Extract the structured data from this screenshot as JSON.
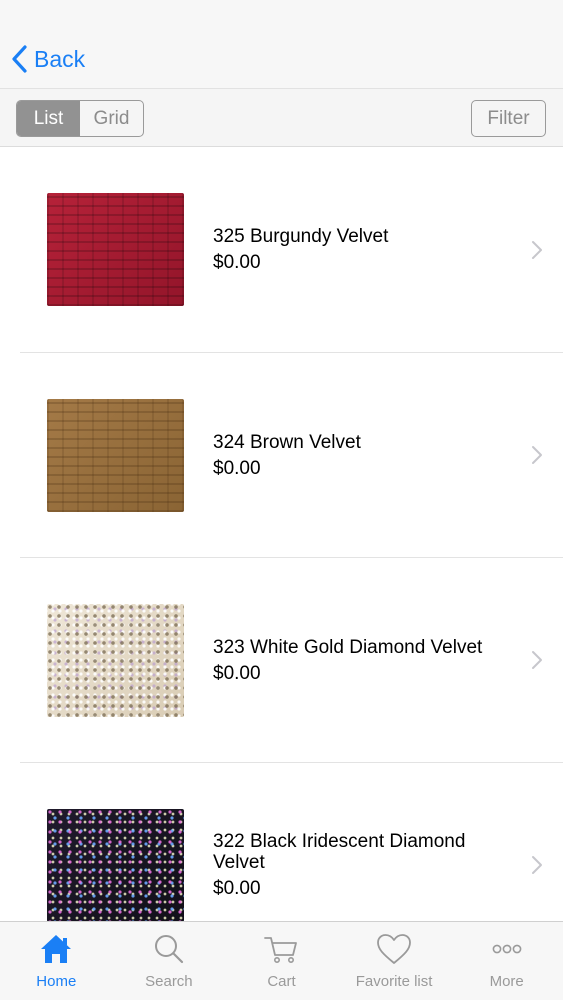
{
  "nav": {
    "back_label": "Back"
  },
  "toolbar": {
    "view_modes": [
      "List",
      "Grid"
    ],
    "active_view": "List",
    "filter_label": "Filter"
  },
  "products": [
    {
      "name": "325 Burgundy Velvet",
      "price": "$0.00",
      "swatch": "burgundy-velvet",
      "color": "#a71a33"
    },
    {
      "name": "324 Brown Velvet",
      "price": "$0.00",
      "swatch": "brown-velvet",
      "color": "#98703e"
    },
    {
      "name": "323 White Gold Diamond Velvet",
      "price": "$0.00",
      "swatch": "white-gold-diamond-velvet",
      "color": "#e5dccb"
    },
    {
      "name": "322 Black Iridescent Diamond Velvet",
      "price": "$0.00",
      "swatch": "black-iridescent-diamond-velvet",
      "color": "#191522"
    }
  ],
  "tabbar": {
    "items": [
      {
        "label": "Home",
        "icon": "home-icon",
        "active": true
      },
      {
        "label": "Search",
        "icon": "search-icon",
        "active": false
      },
      {
        "label": "Cart",
        "icon": "cart-icon",
        "active": false
      },
      {
        "label": "Favorite list",
        "icon": "heart-icon",
        "active": false
      },
      {
        "label": "More",
        "icon": "more-icon",
        "active": false
      }
    ]
  },
  "colors": {
    "accent": "#1a7ff5",
    "inactive": "#9a9a9a",
    "segment_active_bg": "#929292"
  }
}
